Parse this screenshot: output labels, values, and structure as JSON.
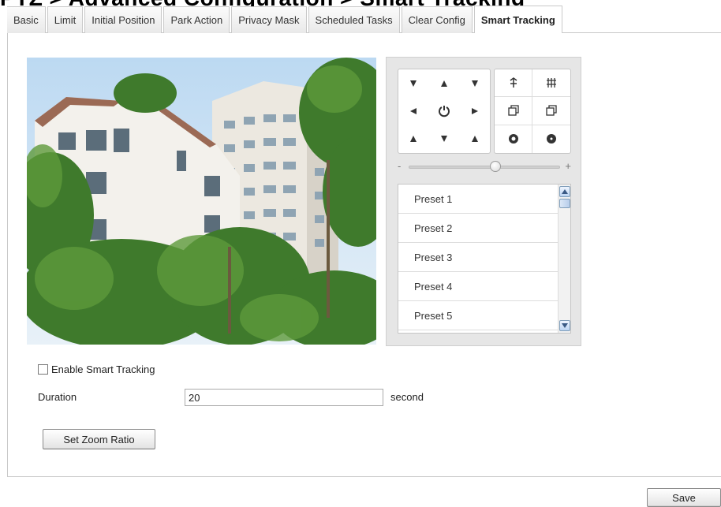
{
  "page": {
    "title": "PTZ > Advanced Configuration > Smart Tracking"
  },
  "tabs": [
    {
      "label": "Basic"
    },
    {
      "label": "Limit"
    },
    {
      "label": "Initial Position"
    },
    {
      "label": "Park Action"
    },
    {
      "label": "Privacy Mask"
    },
    {
      "label": "Scheduled Tasks"
    },
    {
      "label": "Clear Config"
    },
    {
      "label": "Smart Tracking",
      "active": true
    }
  ],
  "ptz": {
    "direction_icons": [
      "arrow-up-left-icon",
      "arrow-up-icon",
      "arrow-up-right-icon",
      "arrow-left-icon",
      "auto-pan-icon",
      "arrow-right-icon",
      "arrow-down-left-icon",
      "arrow-down-icon",
      "arrow-down-right-icon"
    ],
    "lens_icons": [
      "zoom-in-icon",
      "zoom-out-icon",
      "focus-near-icon",
      "focus-far-icon",
      "iris-open-icon",
      "iris-close-icon"
    ],
    "speed_slider": {
      "min_symbol": "-",
      "max_symbol": "+",
      "value_fraction": 0.5
    },
    "presets": [
      "Preset 1",
      "Preset 2",
      "Preset 3",
      "Preset 4",
      "Preset 5"
    ]
  },
  "form": {
    "enable_label": "Enable Smart Tracking",
    "enable_checked": false,
    "duration_label": "Duration",
    "duration_value": "20",
    "duration_unit": "second",
    "zoom_button": "Set Zoom Ratio"
  },
  "footer": {
    "save_label": "Save"
  },
  "colors": {
    "tab_border": "#c9c9c9",
    "ptz_panel_bg": "#e6e6e6",
    "scrollbar_accent": "#7f9db9",
    "sky": "#cfe3f5",
    "foliage": "#3f7a2c"
  }
}
